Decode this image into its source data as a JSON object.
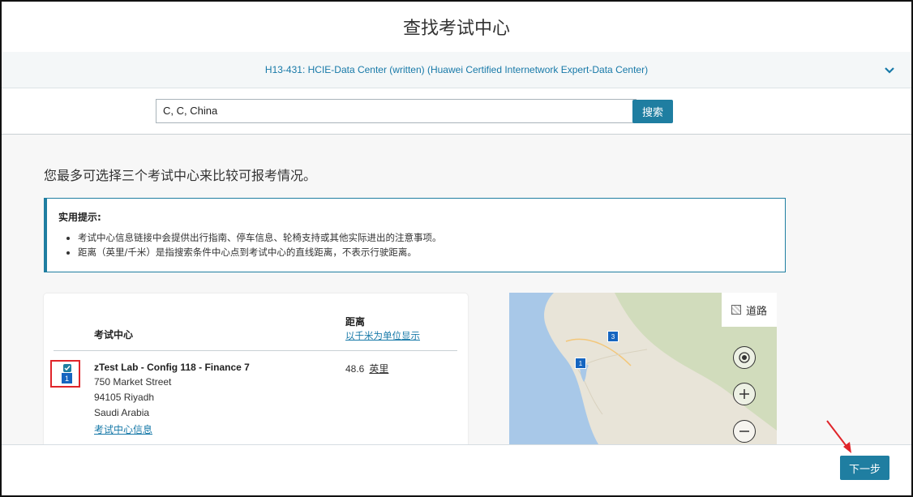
{
  "header": {
    "title": "查找考试中心"
  },
  "exam": {
    "label": "H13-431: HCIE-Data Center (written) (Huawei Certified Internetwork Expert-Data Center)"
  },
  "search": {
    "value": "C, C, China",
    "button_label": "搜索"
  },
  "intro": "您最多可选择三个考试中心来比较可报考情况。",
  "tips": {
    "title": "实用提示:",
    "items": [
      "考试中心信息链接中会提供出行指南、停车信息、轮椅支持或其他实际进出的注意事项。",
      "距离（英里/千米）是指搜索条件中心点到考试中心的直线距离，不表示行驶距离。"
    ]
  },
  "results": {
    "col_center": "考试中心",
    "col_distance": "距离",
    "km_link": "以千米为单位显示",
    "rows": [
      {
        "selected": true,
        "pin": "1",
        "name": "zTest Lab - Config 118 - Finance 7",
        "address": [
          "750 Market Street",
          "94105 Riyadh",
          "Saudi Arabia"
        ],
        "info_link": "考试中心信息",
        "distance": "48.6",
        "unit": "英里"
      }
    ]
  },
  "map": {
    "legend_label": "道路",
    "pins": [
      "1",
      "3"
    ]
  },
  "footer": {
    "next_label": "下一步"
  },
  "colors": {
    "accent": "#1f7ea1",
    "link": "#1779a8",
    "highlight": "#e0252a"
  }
}
